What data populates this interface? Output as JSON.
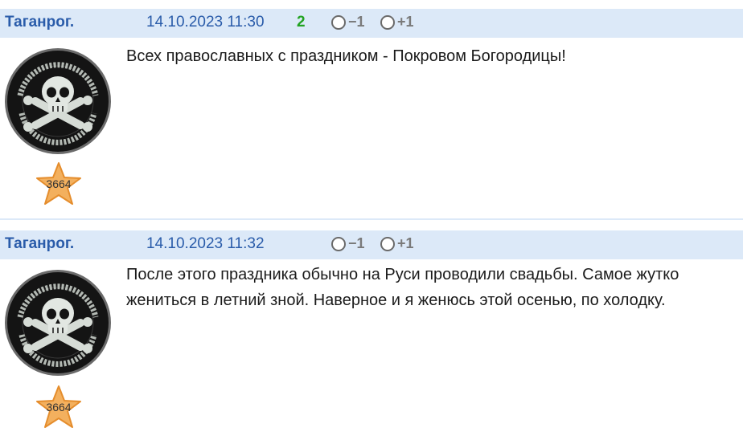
{
  "posts": [
    {
      "author": "Таганрог.",
      "timestamp": "14.10.2023 11:30",
      "score": "2",
      "vote_minus": "−1",
      "vote_plus": "+1",
      "rating": "3664",
      "avatar_icon": "skull-crossbones-patch-icon",
      "lines": [
        "Всех православных с праздником - Покровом Богородицы!"
      ]
    },
    {
      "author": "Таганрог.",
      "timestamp": "14.10.2023 11:32",
      "score": "",
      "vote_minus": "−1",
      "vote_plus": "+1",
      "rating": "3664",
      "avatar_icon": "skull-crossbones-patch-icon",
      "lines": [
        "После этого праздника обычно на Руси проводили свадьбы. Самое жутко",
        "жениться в летний зной. Наверное и я женюсь этой осенью, по холодку."
      ]
    }
  ],
  "colors": {
    "header_bg": "#dce9f8",
    "author": "#2a5caa",
    "score": "#22a322",
    "star": "#f3b05e"
  }
}
